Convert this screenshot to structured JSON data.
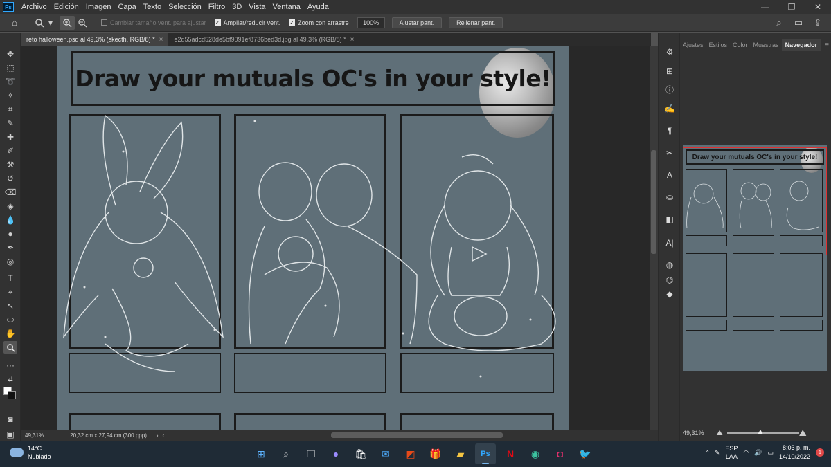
{
  "menu": {
    "items": [
      "Archivo",
      "Edición",
      "Imagen",
      "Capa",
      "Texto",
      "Selección",
      "Filtro",
      "3D",
      "Vista",
      "Ventana",
      "Ayuda"
    ],
    "logo": "Ps"
  },
  "options": {
    "resize_window": "Cambiar tamaño vent. para ajustar",
    "zoom_all": "Ampliar/reducir vent.",
    "scrubby_zoom": "Zoom con arrastre",
    "zoom_value": "100%",
    "fit_screen": "Ajustar pant.",
    "fill_screen": "Rellenar pant."
  },
  "tabs": [
    {
      "label": "reto halloween.psd al 49,3% (skecth, RGB/8) *",
      "active": true
    },
    {
      "label": "e2d55adcd528de5bf9091ef8736bed3d.jpg al 49,3% (RGB/8) *",
      "active": false
    }
  ],
  "canvas": {
    "title": "Draw your mutuals OC's in your style!",
    "background_color": "#5f6f78"
  },
  "status": {
    "zoom": "49,31%",
    "doc_size": "20,32 cm x 27,94 cm (300 ppp)"
  },
  "panel": {
    "tabs": [
      "Ajustes",
      "Estilos",
      "Color",
      "Muestras",
      "Navegador"
    ],
    "active_tab": "Navegador",
    "nav_title": "Draw your mutuals OC's in your style!",
    "zoom": "49,31%"
  },
  "taskbar": {
    "temperature": "14°C",
    "weather": "Nublado",
    "lang": "ESP",
    "layout": "LAA",
    "time": "8:03 p. m.",
    "date": "14/10/2022",
    "notifications": "1"
  },
  "colors": {
    "accent": "#31a8ff",
    "navigator_frame": "#e03030"
  }
}
